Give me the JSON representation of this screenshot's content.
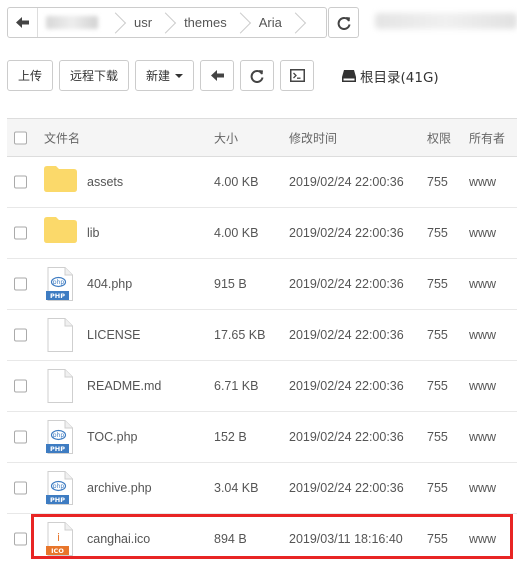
{
  "pathbar": {
    "crumbs": [
      "usr",
      "themes",
      "Aria"
    ]
  },
  "toolbar": {
    "upload_label": "上传",
    "remote_download_label": "远程下载",
    "new_label": "新建",
    "disk_label": "根目录(41G)"
  },
  "table": {
    "headers": {
      "name": "文件名",
      "size": "大小",
      "modified": "修改时间",
      "perm": "权限",
      "owner": "所有者"
    },
    "rows": [
      {
        "name": "assets",
        "type": "folder",
        "size": "4.00 KB",
        "modified": "2019/02/24 22:00:36",
        "perm": "755",
        "owner": "www"
      },
      {
        "name": "lib",
        "type": "folder",
        "size": "4.00 KB",
        "modified": "2019/02/24 22:00:36",
        "perm": "755",
        "owner": "www"
      },
      {
        "name": "404.php",
        "type": "php",
        "size": "915 B",
        "modified": "2019/02/24 22:00:36",
        "perm": "755",
        "owner": "www"
      },
      {
        "name": "LICENSE",
        "type": "file",
        "size": "17.65 KB",
        "modified": "2019/02/24 22:00:36",
        "perm": "755",
        "owner": "www"
      },
      {
        "name": "README.md",
        "type": "file",
        "size": "6.71 KB",
        "modified": "2019/02/24 22:00:36",
        "perm": "755",
        "owner": "www"
      },
      {
        "name": "TOC.php",
        "type": "php",
        "size": "152 B",
        "modified": "2019/02/24 22:00:36",
        "perm": "755",
        "owner": "www"
      },
      {
        "name": "archive.php",
        "type": "php",
        "size": "3.04 KB",
        "modified": "2019/02/24 22:00:36",
        "perm": "755",
        "owner": "www"
      },
      {
        "name": "canghai.ico",
        "type": "ico",
        "size": "894 B",
        "modified": "2019/03/11 18:16:40",
        "perm": "755",
        "owner": "www"
      }
    ]
  },
  "icons": {
    "php_badge": "PHP",
    "php_mark": "php",
    "ico_badge": "ICO",
    "ico_mark": "i"
  },
  "colors": {
    "folder": "#fbd96a",
    "php": "#3e7cc2",
    "ico": "#e8762b",
    "highlight": "#e82524"
  }
}
